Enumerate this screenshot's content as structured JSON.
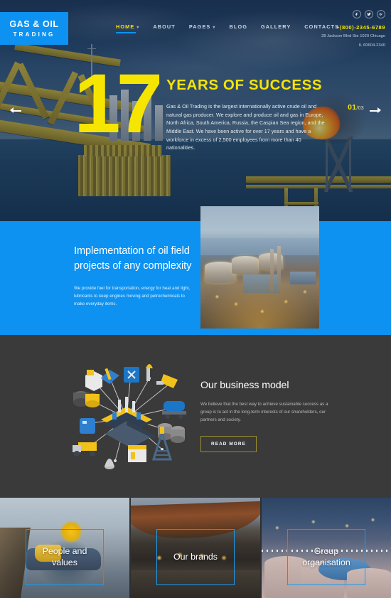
{
  "header": {
    "logo": {
      "line1": "GAS & OIL",
      "line2": "TRADING"
    },
    "nav": [
      {
        "label": "HOME",
        "caret": "▾",
        "active": true
      },
      {
        "label": "ABOUT",
        "caret": "",
        "active": false
      },
      {
        "label": "PAGES",
        "caret": "▾",
        "active": false
      },
      {
        "label": "BLOG",
        "caret": "",
        "active": false
      },
      {
        "label": "GALLERY",
        "caret": "",
        "active": false
      },
      {
        "label": "CONTACTS",
        "caret": "",
        "active": false
      }
    ],
    "socials": [
      {
        "name": "facebook-icon"
      },
      {
        "name": "twitter-icon"
      },
      {
        "name": "google-plus-icon"
      }
    ],
    "phone": "+(800)-2345-6789",
    "address_line1": "28 Jackson Blvd Ste 1020 Chicago",
    "address_line2": "IL 60604-2340"
  },
  "hero": {
    "number": "17",
    "title": "YEARS OF SUCCESS",
    "paragraph": "Gas & Oil Trading is the largest internationally active crude oil and natural gas producer. We explore and produce oil and gas in Europe, North Africa, South America, Russia, the Caspian Sea region, and the Middle East. We have been active for over 17 years and have a workforce in excess of 2,500 employees from more than 40 nationalities.",
    "slide_current": "01",
    "slide_total": "/03",
    "prev_label": "previous-slide",
    "next_label": "next-slide"
  },
  "blue_section": {
    "title": "Implementation of oil field projects of any complexity",
    "text": "We provide fuel for transportation, energy for heat and light, lubricants to keep engines moving and petrochemicals to make everyday items.",
    "image_name": "oil-refinery-at-dusk-photo"
  },
  "business_model": {
    "illustration_name": "isometric-oil-industry-infographic",
    "title": "Our business model",
    "text": "We believe that the best way to achieve sustainable success as a group is to act in the long-term interests of our shareholders, our partners and society.",
    "button_label": "READ MORE"
  },
  "cards": [
    {
      "label": "People and values",
      "image_name": "oil-worker-with-hardhat-photo"
    },
    {
      "label": "Our brands",
      "image_name": "fuel-station-canopy-photo"
    },
    {
      "label": "Group organisation",
      "image_name": "illuminated-storage-tanks-photo"
    }
  ],
  "colors": {
    "brand_blue": "#0d92f2",
    "accent_yellow": "#f6e500",
    "dark_bg": "#3a3a3a",
    "frame_blue": "#1b9bf0",
    "button_border": "#9a8f2e"
  }
}
